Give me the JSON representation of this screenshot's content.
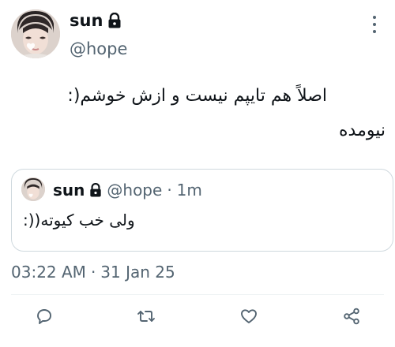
{
  "author": {
    "name": "sun",
    "handle": "@hope",
    "lock_icon": "lock-icon"
  },
  "tweet": {
    "text_line1": "اصلاً هم تایپم نیست و ازش خوشم(:",
    "text_line2": "نیومده"
  },
  "quote": {
    "name": "sun",
    "handle": "@hope",
    "separator": "·",
    "time": "1m",
    "text": "ولی خب کیوته((:"
  },
  "timestamp": {
    "time": "03:22 AM",
    "separator": "·",
    "date": "31 Jan 25"
  },
  "actions": [
    "reply-icon",
    "retweet-icon",
    "like-icon",
    "share-icon"
  ],
  "colors": {
    "text": "#0f1419",
    "secondary": "#536471",
    "border": "#cfd9de"
  }
}
